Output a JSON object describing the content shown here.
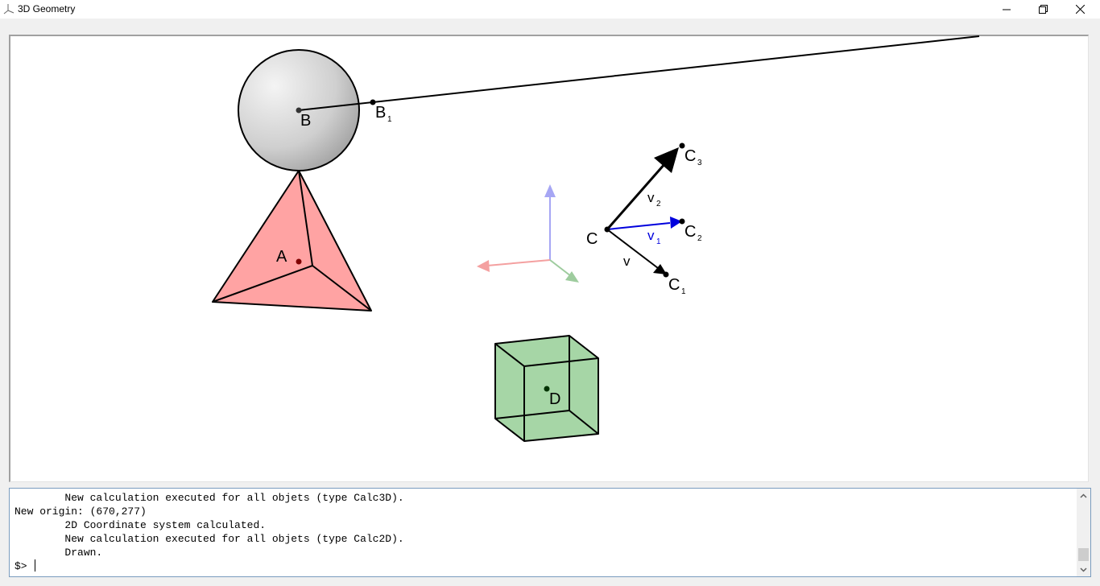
{
  "window": {
    "title": "3D Geometry",
    "icons": [
      "app-axes-icon",
      "minimize-icon",
      "restore-icon",
      "close-icon"
    ]
  },
  "scene": {
    "labels": {
      "A": "A",
      "B": "B",
      "B1": "B",
      "B1_sub": "1",
      "C": "C",
      "C1": "C",
      "C1_sub": "1",
      "C2": "C",
      "C2_sub": "2",
      "C3": "C",
      "C3_sub": "3",
      "D": "D",
      "v": "v",
      "v1": "v",
      "v1_sub": "1",
      "v2": "v",
      "v2_sub": "2"
    },
    "colors": {
      "tetrahedron_fill": "#ffa3a3",
      "cube_fill": "#a6d6a6",
      "vector_v1": "#0000dd",
      "axis_x": "#f4a0a0",
      "axis_y": "#9ecc9e",
      "axis_z": "#a6a6f4",
      "point_A": "#800000",
      "point_D": "#003300"
    }
  },
  "console": {
    "lines": [
      "        New calculation executed for all objets (type Calc3D).",
      "New origin: (670,277)",
      "        2D Coordinate system calculated.",
      "        New calculation executed for all objets (type Calc2D).",
      "        Drawn."
    ],
    "prompt": "$>"
  }
}
